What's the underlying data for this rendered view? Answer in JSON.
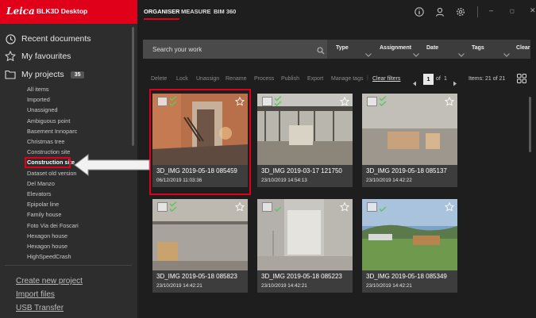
{
  "brand": {
    "logo": "Leica",
    "app_name": "BLK3D Desktop"
  },
  "tabs": [
    {
      "label": "ORGANISER"
    },
    {
      "label": "MEASURE"
    },
    {
      "label": "BIM 360"
    }
  ],
  "sidebar": {
    "nav": [
      {
        "label": "Recent documents",
        "icon": "clock-icon"
      },
      {
        "label": "My favourites",
        "icon": "star-icon"
      },
      {
        "label": "My projects",
        "icon": "folder-icon",
        "count": "35"
      }
    ],
    "projects": [
      "All items",
      "Imported",
      "Unassigned",
      "Ambiguous point",
      "Basement Innoparc",
      "Christmas tree",
      "Construction site",
      "Construction site",
      "Dataset old version",
      "Del Manzo",
      "Elevators",
      "Epipolar line",
      "Family house",
      "Foto Via dei Foscari",
      "Hexagon house",
      "Hexagon house",
      "HighSpeedCrash"
    ],
    "selected_index": 7,
    "bottom_links": [
      "Create new project",
      "Import files",
      "USB Transfer"
    ]
  },
  "filters": {
    "search_placeholder": "Search your work",
    "dropdowns": [
      "Type",
      "Assignment",
      "Date",
      "Tags"
    ],
    "clear": "Clear"
  },
  "actions": {
    "items": [
      "Delete",
      "Lock",
      "Unassign",
      "Rename",
      "Process",
      "Publish",
      "Export",
      "Manage tags"
    ],
    "clear_filters": "Clear filters",
    "page": "1",
    "of_label": "of",
    "total_pages": "1",
    "items_label": "Items: 21 of 21"
  },
  "cards": [
    {
      "title": "3D_IMG 2019-05-18 085459",
      "date": "06/12/2019 11:03:36"
    },
    {
      "title": "3D_IMG 2019-03-17 121750",
      "date": "23/10/2019 14:54:13"
    },
    {
      "title": "3D_IMG 2019-05-18 085137",
      "date": "23/10/2019 14:42:22"
    },
    {
      "title": "3D_IMG 2019-05-18 085823",
      "date": "23/10/2019 14:42:21"
    },
    {
      "title": "3D_IMG 2019-05-18 085223",
      "date": "23/10/2019 14:42:21"
    },
    {
      "title": "3D_IMG 2019-05-18 085349",
      "date": "23/10/2019 14:42:21"
    }
  ],
  "colors": {
    "accent": "#e0001a",
    "check": "#5cc85c"
  }
}
